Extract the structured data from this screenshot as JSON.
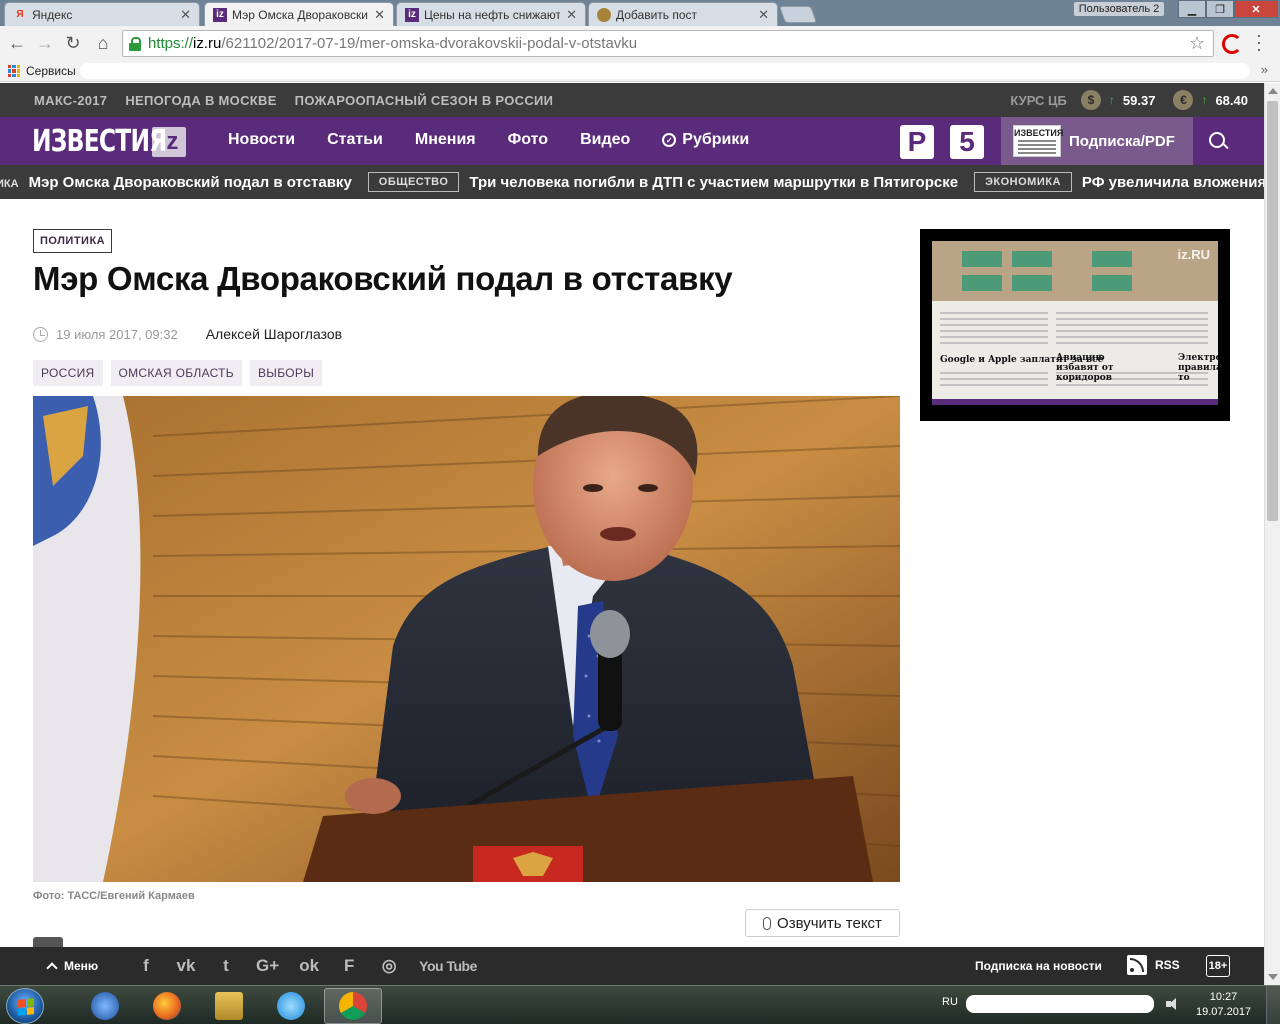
{
  "browser": {
    "tabs": [
      {
        "title": "Яндекс",
        "icon": "yandex-icon",
        "active": false
      },
      {
        "title": "Мэр Омска Двораковски",
        "icon": "iz-icon",
        "active": true
      },
      {
        "title": "Цены на нефть снижают",
        "icon": "iz-icon",
        "active": false
      },
      {
        "title": "Добавить пост",
        "icon": "pikabu-icon",
        "active": false
      }
    ],
    "profile_label": "Пользователь 2",
    "url_scheme": "https://",
    "url_host": "iz.ru",
    "url_path": "/621102/2017-07-19/mer-omska-dvorakovskii-podal-v-otstavku",
    "bookmarks_apps_label": "Сервисы",
    "bookmarks_more": "»"
  },
  "site": {
    "topics": [
      "МАКС-2017",
      "НЕПОГОДА В МОСКВЕ",
      "ПОЖАРООПАСНЫЙ СЕЗОН В РОССИИ"
    ],
    "rates": {
      "label": "КУРС ЦБ",
      "usd_symbol": "$",
      "usd_value": "59.37",
      "eur_symbol": "€",
      "eur_value": "68.40",
      "up_arrow": "↑"
    },
    "logo_word": "ИЗВЕСТИЯ",
    "logo_badge": "iz",
    "nav": [
      "Новости",
      "Статьи",
      "Мнения",
      "Фото",
      "Видео",
      "Рубрики"
    ],
    "channels": {
      "ren": "Р",
      "five": "5"
    },
    "subscription": {
      "label": "Подписка/PDF",
      "paper_title": "ИЗВЕСТИЯ"
    },
    "ticker": [
      {
        "tag": "",
        "prefix": "ИКА",
        "text": "Мэр Омска Двораковский подал в отставку"
      },
      {
        "tag": "ОБЩЕСТВО",
        "text": "Три человека погибли в ДТП с участием маршрутки в Пятигорске"
      },
      {
        "tag": "ЭКОНОМИКА",
        "text": "РФ увеличила вложения"
      }
    ]
  },
  "article": {
    "category": "ПОЛИТИКА",
    "title": "Мэр Омска Двораковский подал в отставку",
    "date": "19 июля 2017, 09:32",
    "author": "Алексей Шароглазов",
    "tags": [
      "РОССИЯ",
      "ОМСКАЯ ОБЛАСТЬ",
      "ВЫБОРЫ"
    ],
    "photo_caption": "Фото: ТАСС/Евгений Кармаев",
    "voice_button": "Озвучить текст"
  },
  "sidebar_video": {
    "watermark": "iz.RU",
    "headline1": "Google и Apple заплатят за всё",
    "headline2": "Авиацию избавят от коридоров",
    "headline3": "Электромо правила то"
  },
  "bottom_bar": {
    "menu_label": "Меню",
    "socials": [
      "f",
      "vk",
      "twitter",
      "G+",
      "ok",
      "flipboard",
      "instagram",
      "YouTube"
    ],
    "social_glyphs": {
      "facebook": "f",
      "vk": "vk",
      "twitter": "t",
      "gplus": "G+",
      "ok": "ok",
      "flipboard": "F",
      "instagram": "◎",
      "youtube": "You Tube"
    },
    "subscribe_news": "Подписка на новости",
    "rss_label": "RSS",
    "age_label": "18+"
  },
  "taskbar": {
    "lang": "RU",
    "time": "10:27",
    "date": "19.07.2017"
  }
}
